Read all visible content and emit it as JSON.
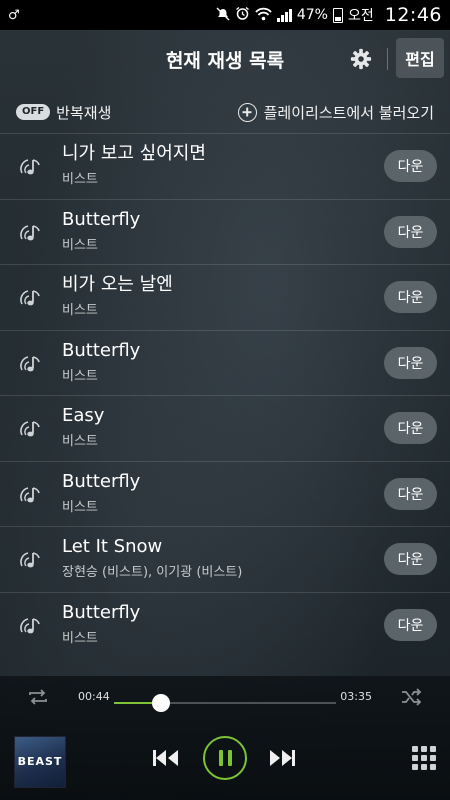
{
  "status_bar": {
    "carrier_icon": "gender-symbol-icon",
    "battery_percent": "47%",
    "ampm": "오전",
    "time": "12:46"
  },
  "header": {
    "title": "현재 재생 목록",
    "settings_icon": "gear-icon",
    "edit_label": "편집"
  },
  "options": {
    "repeat_toggle": "OFF",
    "repeat_label": "반복재생",
    "load_label": "플레이리스트에서 불러오기"
  },
  "songs": [
    {
      "title": "니가 보고 싶어지면",
      "artist": "비스트",
      "action": "다운"
    },
    {
      "title": "Butterfly",
      "artist": "비스트",
      "action": "다운"
    },
    {
      "title": "비가 오는 날엔",
      "artist": "비스트",
      "action": "다운"
    },
    {
      "title": "Butterfly",
      "artist": "비스트",
      "action": "다운"
    },
    {
      "title": "Easy",
      "artist": "비스트",
      "action": "다운"
    },
    {
      "title": "Butterfly",
      "artist": "비스트",
      "action": "다운"
    },
    {
      "title": "Let It Snow",
      "artist": "장현승 (비스트), 이기광 (비스트)",
      "action": "다운"
    },
    {
      "title": "Butterfly",
      "artist": "비스트",
      "action": "다운"
    }
  ],
  "player": {
    "current_time": "00:44",
    "total_time": "03:35",
    "progress": 0.21,
    "album_text": "BEAST",
    "accent_color": "#7dc335"
  }
}
